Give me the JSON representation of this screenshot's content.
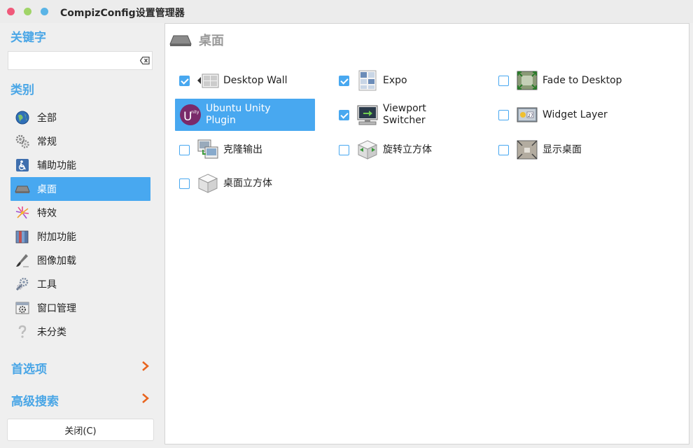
{
  "window": {
    "title": "CompizConfig设置管理器"
  },
  "sidebar": {
    "keyword_heading": "关键字",
    "search_placeholder": "",
    "category_heading": "类别",
    "categories": [
      {
        "label": "全部",
        "icon": "globe-icon"
      },
      {
        "label": "常规",
        "icon": "gears-icon"
      },
      {
        "label": "辅助功能",
        "icon": "accessibility-icon"
      },
      {
        "label": "桌面",
        "icon": "desktop-icon",
        "active": true
      },
      {
        "label": "特效",
        "icon": "fireworks-icon"
      },
      {
        "label": "附加功能",
        "icon": "books-icon"
      },
      {
        "label": "图像加载",
        "icon": "brush-icon"
      },
      {
        "label": "工具",
        "icon": "tools-icon"
      },
      {
        "label": "窗口管理",
        "icon": "window-gear-icon"
      },
      {
        "label": "未分类",
        "icon": "question-icon"
      }
    ],
    "preferences_label": "首选项",
    "advanced_search_label": "高级搜索",
    "close_label": "关闭(C)"
  },
  "main": {
    "title": "桌面",
    "plugins": [
      {
        "label": "Desktop Wall",
        "checked": true,
        "icon": "desktop-wall-icon"
      },
      {
        "label": "Expo",
        "checked": true,
        "icon": "expo-icon"
      },
      {
        "label": "Fade to Desktop",
        "checked": false,
        "icon": "fade-desktop-icon"
      },
      {
        "label": "Ubuntu Unity Plugin",
        "checked": null,
        "icon": "unity-icon",
        "selected": true
      },
      {
        "label": "Viewport Switcher",
        "checked": true,
        "icon": "viewport-switcher-icon"
      },
      {
        "label": "Widget Layer",
        "checked": false,
        "icon": "widget-layer-icon"
      },
      {
        "label": "克隆输出",
        "checked": false,
        "icon": "clone-output-icon"
      },
      {
        "label": "旋转立方体",
        "checked": false,
        "icon": "rotate-cube-icon"
      },
      {
        "label": "显示桌面",
        "checked": false,
        "icon": "show-desktop-icon"
      },
      {
        "label": "桌面立方体",
        "checked": false,
        "icon": "desktop-cube-icon"
      }
    ]
  },
  "colors": {
    "accent": "#48a8f0",
    "heading": "#4aa6e6",
    "chevron": "#e8641e"
  }
}
